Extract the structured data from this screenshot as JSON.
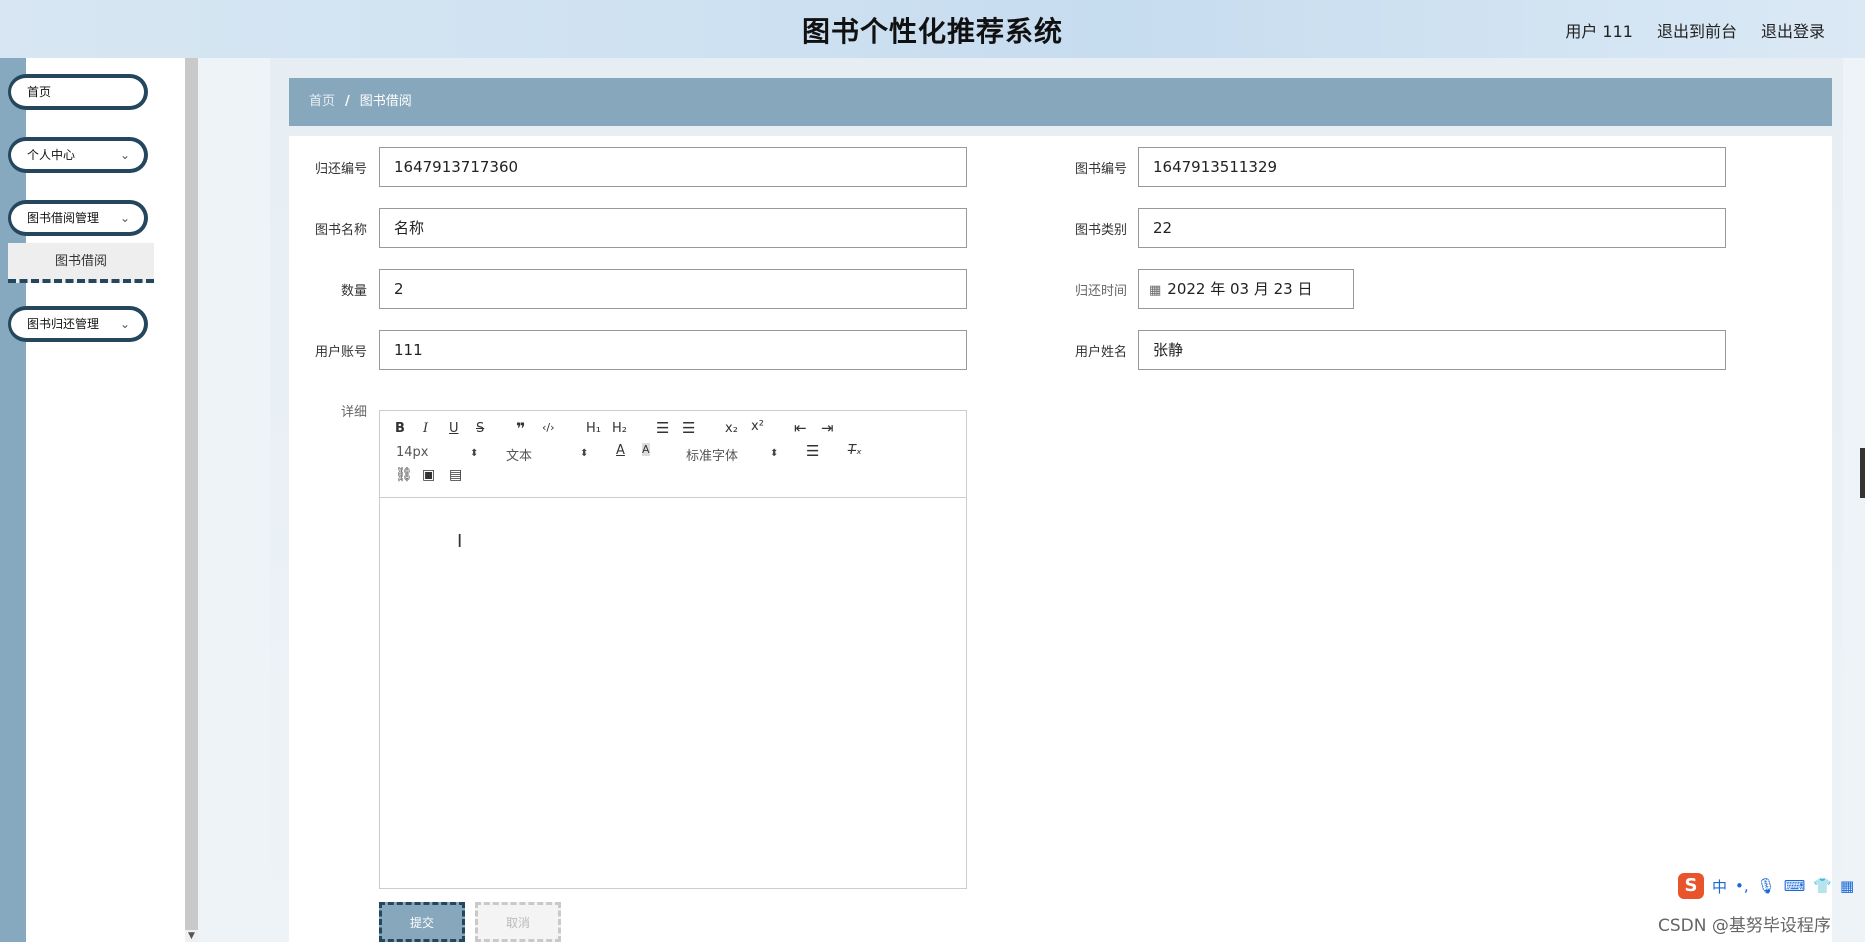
{
  "header": {
    "title": "图书个性化推荐系统",
    "user": "用户 111",
    "front": "退出到前台",
    "logout": "退出登录"
  },
  "sidebar": {
    "items": [
      {
        "label": "首页"
      },
      {
        "label": "个人中心"
      },
      {
        "label": "图书借阅管理"
      },
      {
        "label": "图书归还管理"
      }
    ],
    "sub_item": "图书借阅"
  },
  "breadcrumb": {
    "home": "首页",
    "separator": "/",
    "current": "图书借阅"
  },
  "form": {
    "return_no": {
      "label": "归还编号",
      "value": "1647913717360"
    },
    "book_no": {
      "label": "图书编号",
      "value": "1647913511329"
    },
    "book_name": {
      "label": "图书名称",
      "value": "名称"
    },
    "book_category": {
      "label": "图书类别",
      "value": "22"
    },
    "quantity": {
      "label": "数量",
      "value": "2"
    },
    "return_time": {
      "label": "归还时间",
      "value": "2022 年 03 月 23 日"
    },
    "user_account": {
      "label": "用户账号",
      "value": "111"
    },
    "user_name": {
      "label": "用户姓名",
      "value": "张静"
    },
    "detail": {
      "label": "详细"
    }
  },
  "editor": {
    "size": "14px",
    "header_select": "文本",
    "font_select": "标准字体"
  },
  "buttons": {
    "submit": "提交",
    "cancel": "取消"
  },
  "ime": {
    "logo": "S",
    "lang": "中",
    "punct": "•,"
  },
  "watermark": "CSDN @基努毕设程序"
}
